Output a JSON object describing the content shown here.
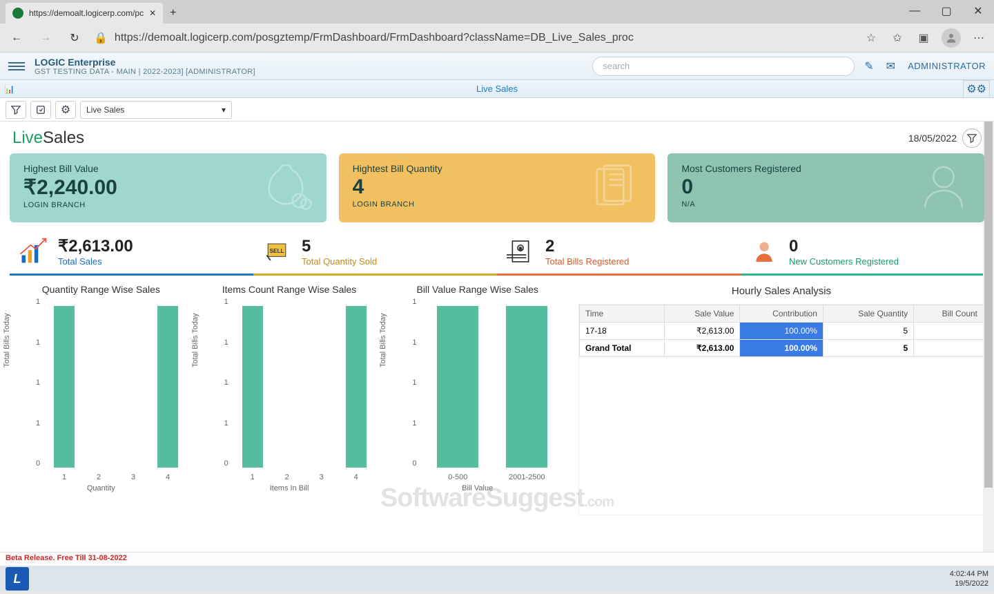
{
  "browser": {
    "tab_title": "https://demoalt.logicerp.com/pc",
    "url": "https://demoalt.logicerp.com/posgztemp/FrmDashboard/FrmDashboard?className=DB_Live_Sales_proc"
  },
  "header": {
    "app_title": "LOGIC Enterprise",
    "subtitle": "GST TESTING DATA - MAIN | 2022-2023] [ADMINISTRATOR]",
    "search_placeholder": "search",
    "admin_label": "ADMINISTRATOR"
  },
  "page_tab": {
    "label": "Live Sales",
    "dropdown_value": "Live Sales"
  },
  "page": {
    "title_live": "Live",
    "title_sales": "Sales",
    "date": "18/05/2022"
  },
  "kpi": [
    {
      "label": "Highest Bill Value",
      "value": "₹2,240.00",
      "sub": "LOGIN BRANCH"
    },
    {
      "label": "Hightest Bill Quantity",
      "value": "4",
      "sub": "LOGIN BRANCH"
    },
    {
      "label": "Most Customers Registered",
      "value": "0",
      "sub": "N/A"
    }
  ],
  "stats": [
    {
      "value": "₹2,613.00",
      "label": "Total Sales"
    },
    {
      "value": "5",
      "label": "Total Quantity Sold"
    },
    {
      "value": "2",
      "label": "Total Bills Registered"
    },
    {
      "value": "0",
      "label": "New Customers Registered"
    }
  ],
  "chart_data": [
    {
      "type": "bar",
      "title": "Quantity Range Wise Sales",
      "xlabel": "Quantity",
      "ylabel": "Total Bills Today",
      "categories": [
        "1",
        "2",
        "3",
        "4"
      ],
      "values": [
        1,
        0,
        0,
        1
      ],
      "ylim": [
        0,
        1
      ],
      "yticks": [
        0,
        1,
        1,
        1,
        1
      ]
    },
    {
      "type": "bar",
      "title": "Items Count Range Wise Sales",
      "xlabel": "Items In Bill",
      "ylabel": "Total Bills Today",
      "categories": [
        "1",
        "2",
        "3",
        "4"
      ],
      "values": [
        1,
        0,
        0,
        1
      ],
      "ylim": [
        0,
        1
      ],
      "yticks": [
        0,
        1,
        1,
        1,
        1
      ]
    },
    {
      "type": "bar",
      "title": "Bill Value Range Wise Sales",
      "xlabel": "Bill Value",
      "ylabel": "Total Bills Today",
      "categories": [
        "0-500",
        "2001-2500"
      ],
      "values": [
        1,
        1
      ],
      "ylim": [
        0,
        1
      ],
      "yticks": [
        0,
        1,
        1,
        1,
        1
      ]
    }
  ],
  "hourly_table": {
    "title": "Hourly Sales Analysis",
    "headers": [
      "Time",
      "Sale Value",
      "Contribution",
      "Sale Quantity",
      "Bill Count"
    ],
    "rows": [
      {
        "time": "17-18",
        "sale_value": "₹2,613.00",
        "contribution": "100.00%",
        "sale_qty": "5",
        "bill_count": ""
      }
    ],
    "total": {
      "label": "Grand Total",
      "sale_value": "₹2,613.00",
      "contribution": "100.00%",
      "sale_qty": "5",
      "bill_count": ""
    }
  },
  "footer": {
    "beta_text": "Beta Release. Free Till 31-08-2022",
    "clock_time": "4:02:44 PM",
    "clock_date": "19/5/2022"
  },
  "watermark": {
    "main": "SoftwareSuggest",
    "suffix": ".com"
  }
}
